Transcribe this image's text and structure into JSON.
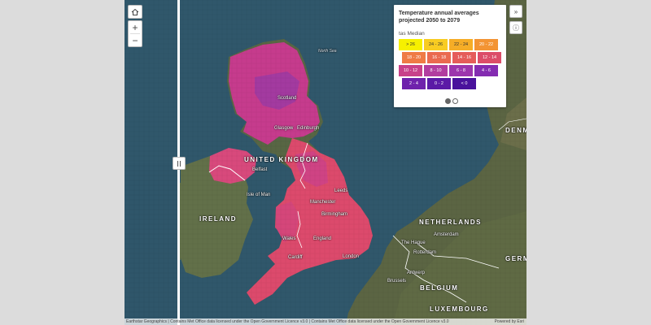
{
  "legend": {
    "title": "Temperature annual averages projected 2050 to 2079",
    "subtitle": "tas Median",
    "swatches": [
      {
        "label": "> 26",
        "color": "#f6f000"
      },
      {
        "label": "24 - 26",
        "color": "#f8cc22"
      },
      {
        "label": "22 - 24",
        "color": "#f6ad27"
      },
      {
        "label": "20 - 22",
        "color": "#f39434"
      },
      {
        "label": "18 - 20",
        "color": "#ef7b45"
      },
      {
        "label": "16 - 18",
        "color": "#ea6a50"
      },
      {
        "label": "14 - 16",
        "color": "#e55c5a"
      },
      {
        "label": "12 - 14",
        "color": "#dc4d69"
      },
      {
        "label": "10 - 12",
        "color": "#c8418a"
      },
      {
        "label": "8 - 10",
        "color": "#b23da0"
      },
      {
        "label": "6 - 8",
        "color": "#9c35ad"
      },
      {
        "label": "4 - 6",
        "color": "#842cb1"
      },
      {
        "label": "2 - 4",
        "color": "#6f22ac"
      },
      {
        "label": "0 - 2",
        "color": "#5b1aa6"
      },
      {
        "label": "< 0",
        "color": "#4a129c"
      }
    ]
  },
  "labels": {
    "united_kingdom": "UNITED KINGDOM",
    "ireland": "IRELAND",
    "netherlands": "NETHERLANDS",
    "belgium": "BELGIUM",
    "luxembourg": "LUXEMBOURG",
    "denmark_partial": "DENM",
    "germany_partial": "GERM",
    "north_sea": "North Sea",
    "scotland": "Scotland",
    "glasgow": "Glasgow",
    "edinburgh": "Edinburgh",
    "belfast": "Belfast",
    "leeds": "Leeds",
    "manchester": "Manchester",
    "birmingham": "Birmingham",
    "england": "England",
    "wales": "Wales",
    "cardiff": "Cardiff",
    "london": "London",
    "amsterdam": "Amsterdam",
    "the_hague": "The Hague",
    "rotterdam": "Rotterdam",
    "antwerp": "Antwerp",
    "brussels": "Brussels",
    "isle_of_man": "Isle of Man"
  },
  "attribution": "Earthstar Geographics | Contains Met Office data licensed under the Open Government Licence v3.0 | Contains Met Office data licensed under the Open Government Licence v3.0",
  "powered_by": "Powered by Esri",
  "icons": {
    "home": "home-icon",
    "zoom_in": "plus-icon",
    "zoom_out": "minus-icon",
    "expand": "double-chevron-icon",
    "info": "info-icon",
    "swipe": "grip-icon"
  },
  "pagination": {
    "total": 2,
    "active": 1
  }
}
